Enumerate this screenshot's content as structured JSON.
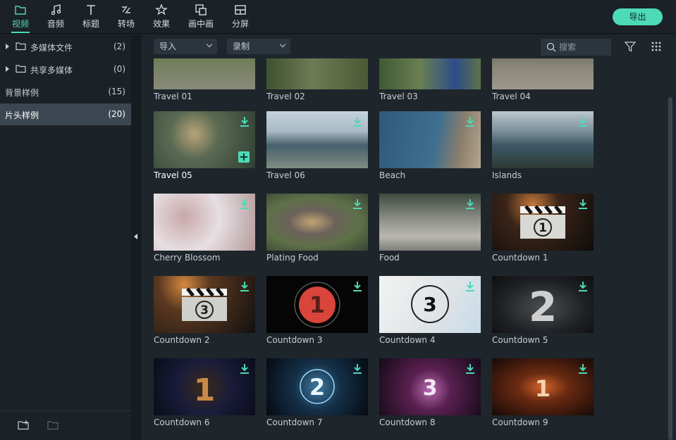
{
  "topbar": {
    "tabs": [
      {
        "label": "视频",
        "icon": "folder-icon",
        "active": true
      },
      {
        "label": "音频",
        "icon": "music-note-icon",
        "active": false
      },
      {
        "label": "标题",
        "icon": "text-icon",
        "active": false
      },
      {
        "label": "转场",
        "icon": "transition-icon",
        "active": false
      },
      {
        "label": "效果",
        "icon": "effects-icon",
        "active": false
      },
      {
        "label": "画中画",
        "icon": "pip-icon",
        "active": false
      },
      {
        "label": "分屏",
        "icon": "split-screen-icon",
        "active": false
      }
    ],
    "export_label": "导出"
  },
  "sidebar": {
    "items": [
      {
        "label": "多媒体文件",
        "count": "(2)"
      },
      {
        "label": "共享多媒体",
        "count": "(0)"
      },
      {
        "label": "背景样例",
        "count": "(15)"
      },
      {
        "label": "片头样例",
        "count": "(20)"
      }
    ]
  },
  "toolbar": {
    "import_label": "导入",
    "record_label": "录制",
    "search_placeholder": "搜索"
  },
  "grid": {
    "items": [
      {
        "title": "Travel 01"
      },
      {
        "title": "Travel 02"
      },
      {
        "title": "Travel 03"
      },
      {
        "title": "Travel 04"
      },
      {
        "title": "Travel 05"
      },
      {
        "title": "Travel 06"
      },
      {
        "title": "Beach"
      },
      {
        "title": "Islands"
      },
      {
        "title": "Cherry Blossom"
      },
      {
        "title": "Plating Food"
      },
      {
        "title": "Food"
      },
      {
        "title": "Countdown 1"
      },
      {
        "title": "Countdown 2"
      },
      {
        "title": "Countdown 3"
      },
      {
        "title": "Countdown 4"
      },
      {
        "title": "Countdown 5"
      },
      {
        "title": "Countdown 6"
      },
      {
        "title": "Countdown 7"
      },
      {
        "title": "Countdown 8"
      },
      {
        "title": "Countdown 9"
      }
    ],
    "countdown_digits": [
      "1",
      "3",
      "1",
      "3",
      "2",
      "1",
      "2",
      "3",
      "1"
    ]
  },
  "colors": {
    "accent": "#4ddab6",
    "background": "#1b2127",
    "panel": "#1e252b",
    "selected": "#3b4650"
  }
}
